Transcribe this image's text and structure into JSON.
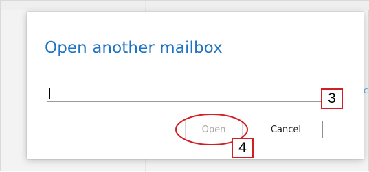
{
  "dialog": {
    "title": "Open another mailbox",
    "input": {
      "value": "",
      "placeholder": ""
    },
    "buttons": {
      "open_label": "Open",
      "cancel_label": "Cancel"
    }
  },
  "background": {
    "right_edge_char": "c"
  },
  "annotations": {
    "callout_3": "3",
    "callout_4": "4",
    "highlight_color": "#d21f26"
  },
  "colors": {
    "title": "#1f73c1",
    "disabled_text": "#a8a8a8",
    "annotation_red": "#d21f26"
  }
}
